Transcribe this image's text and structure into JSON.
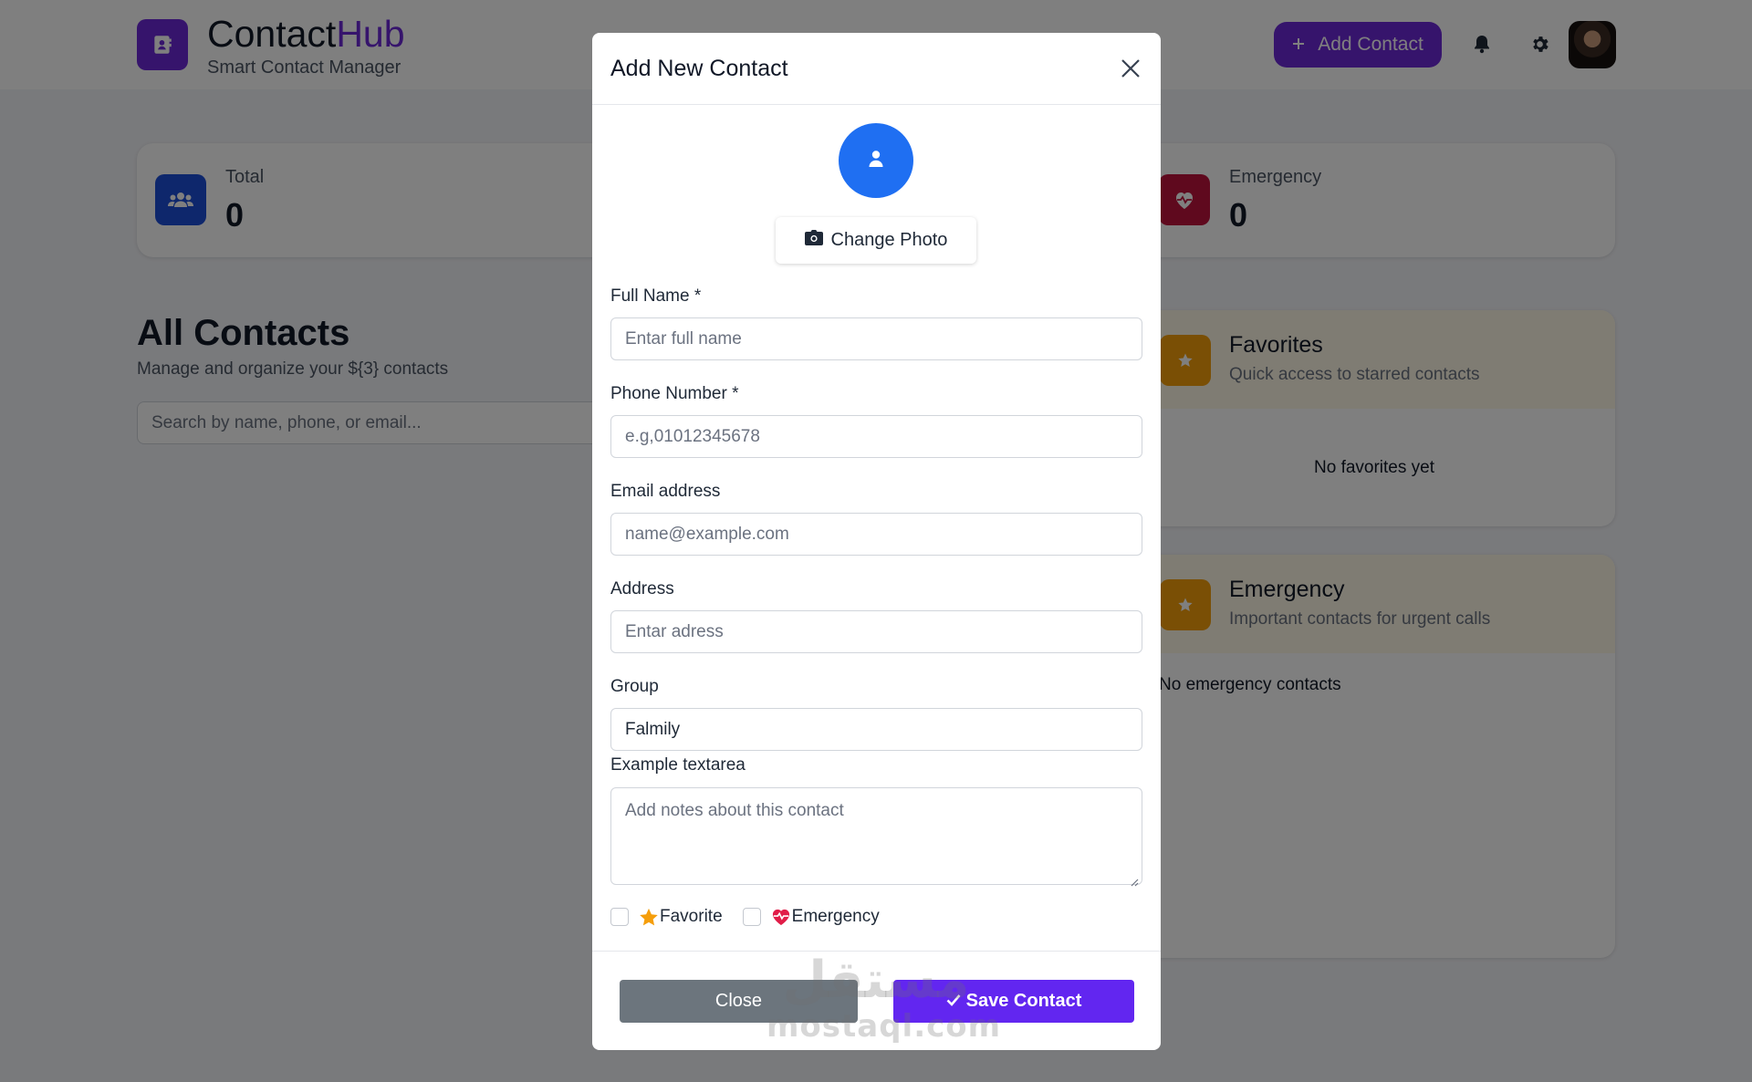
{
  "header": {
    "brand_first": "Contact",
    "brand_second": "Hub",
    "tagline": "Smart Contact Manager",
    "add_contact_label": "Add Contact",
    "icons": [
      "address-book-icon",
      "plus-icon",
      "bell-icon",
      "gear-icon"
    ]
  },
  "stats": {
    "total_label": "Total",
    "total_value": "0",
    "emergency_label": "Emergency",
    "emergency_value": "0"
  },
  "main": {
    "title": "All Contacts",
    "subtitle": "Manage and organize your ${3} contacts",
    "search_placeholder": "Search by name, phone, or email..."
  },
  "sidebar": {
    "favorites": {
      "title": "Favorites",
      "subtitle": "Quick access to starred contacts",
      "empty_text": "No favorites yet"
    },
    "emergency": {
      "title": "Emergency",
      "subtitle": "Important contacts for urgent calls",
      "empty_text": "No emergency contacts"
    }
  },
  "modal": {
    "title": "Add New Contact",
    "change_photo_label": "Change Photo",
    "fields": {
      "full_name_label": "Full Name *",
      "full_name_placeholder": "Entar full name",
      "phone_label": "Phone Number *",
      "phone_placeholder": "e.g,01012345678",
      "email_label": "Email address",
      "email_placeholder": "name@example.com",
      "address_label": "Address",
      "address_placeholder": "Entar adress",
      "group_label": "Group",
      "group_value": "Falmily",
      "notes_label": "Example textarea",
      "notes_placeholder": "Add notes about this contact"
    },
    "checkboxes": {
      "favorite_label": "Favorite",
      "emergency_label": "Emergency",
      "favorite_checked": false,
      "emergency_checked": false
    },
    "close_label": "Close",
    "save_label": "Save Contact"
  },
  "colors": {
    "brand": "#6d28d9",
    "save_button": "#6226f0",
    "close_button": "#6c757d",
    "photo_circle": "#1f6ff2",
    "total_icon_bg": "#1d4ed8",
    "emergency_icon_bg": "#be123c",
    "favorites_icon_bg": "#f59e0b"
  },
  "watermark": {
    "arabic": "مستقل",
    "latin": "mostaql.com"
  }
}
